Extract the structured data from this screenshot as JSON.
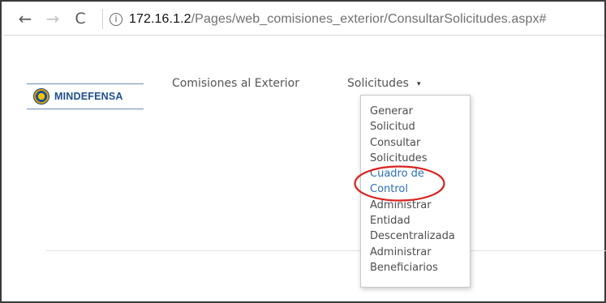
{
  "browser": {
    "url_host": "172.16.1.2",
    "url_path": "/Pages/web_comisiones_exterior/ConsultarSolicitudes.aspx#",
    "back_icon": "←",
    "forward_icon": "→",
    "reload_icon": "C",
    "info_icon": "i"
  },
  "brand": {
    "logo_text": "MINDEFENSA"
  },
  "nav": {
    "comisiones_label": "Comisiones al Exterior",
    "solicitudes_label": "Solicitudes",
    "caret": "▾"
  },
  "dropdown": {
    "items": [
      "Generar",
      "Solicitud",
      "Consultar",
      "Solicitudes",
      "Cuadro de",
      "Control",
      "Administrar",
      "Entidad",
      "Descentralizada",
      "Administrar",
      "Beneficiarios"
    ]
  },
  "colors": {
    "highlight_ellipse": "#d9231f",
    "active_link": "#2a6fbb",
    "brand_blue": "#1e4f8f"
  }
}
